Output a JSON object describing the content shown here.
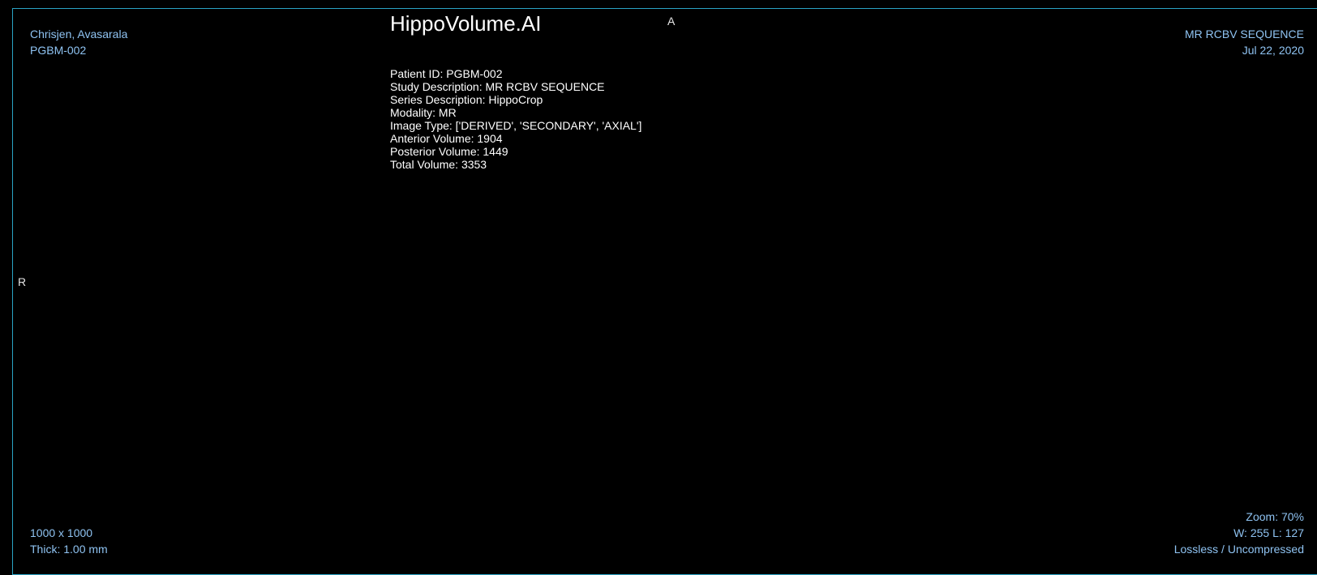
{
  "overlay": {
    "top_left": {
      "patient_name": "Chrisjen, Avasarala",
      "patient_id": "PGBM-002"
    },
    "top_right": {
      "study_description": "MR RCBV SEQUENCE",
      "study_date": "Jul 22, 2020"
    },
    "bottom_left": {
      "dimensions": "1000 x 1000",
      "thickness": "Thick: 1.00 mm"
    },
    "bottom_right": {
      "zoom": "Zoom: 70%",
      "window_level": "W: 255 L: 127",
      "compression": "Lossless / Uncompressed"
    }
  },
  "orientation": {
    "top": "A",
    "left": "R"
  },
  "report": {
    "title": "HippoVolume.AI",
    "lines": [
      "Patient ID: PGBM-002",
      "Study Description: MR RCBV SEQUENCE",
      "Series Description: HippoCrop",
      "Modality: MR",
      "Image Type: ['DERIVED', 'SECONDARY', 'AXIAL']",
      "Anterior Volume: 1904",
      "Posterior Volume: 1449",
      "Total Volume: 3353"
    ]
  },
  "colors": {
    "background": "#000000",
    "viewport_border": "#2aa3c4",
    "overlay_text": "#8fc3f2",
    "report_text": "#ffffff"
  }
}
